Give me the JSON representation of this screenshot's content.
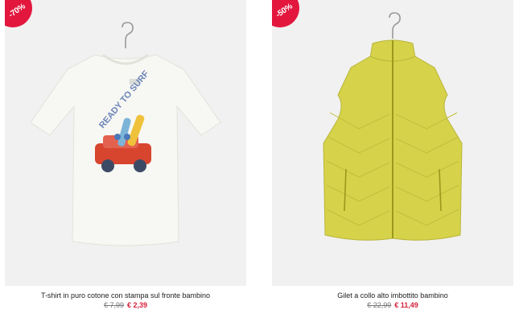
{
  "products": [
    {
      "discount": "-70%",
      "name": "T-shirt in puro cotone con stampa sul fronte bambino",
      "old_price": "€ 7,99",
      "price": "€ 2,39",
      "image_icon": "tshirt-icon",
      "print_text": "READY TO SURF",
      "colors": {
        "garment": "#f7f7f3",
        "print_car": "#d8452f",
        "print_board": "#f0c23b"
      }
    },
    {
      "discount": "-50%",
      "name": "Gilet a collo alto imbottito bambino",
      "old_price": "€ 22,99",
      "price": "€ 11,49",
      "image_icon": "vest-icon",
      "colors": {
        "garment": "#d6d24a",
        "zip": "#9c981c"
      }
    }
  ],
  "colors": {
    "badge": "#e3173e",
    "price": "#d6213a",
    "background": "#f1f1f1"
  }
}
